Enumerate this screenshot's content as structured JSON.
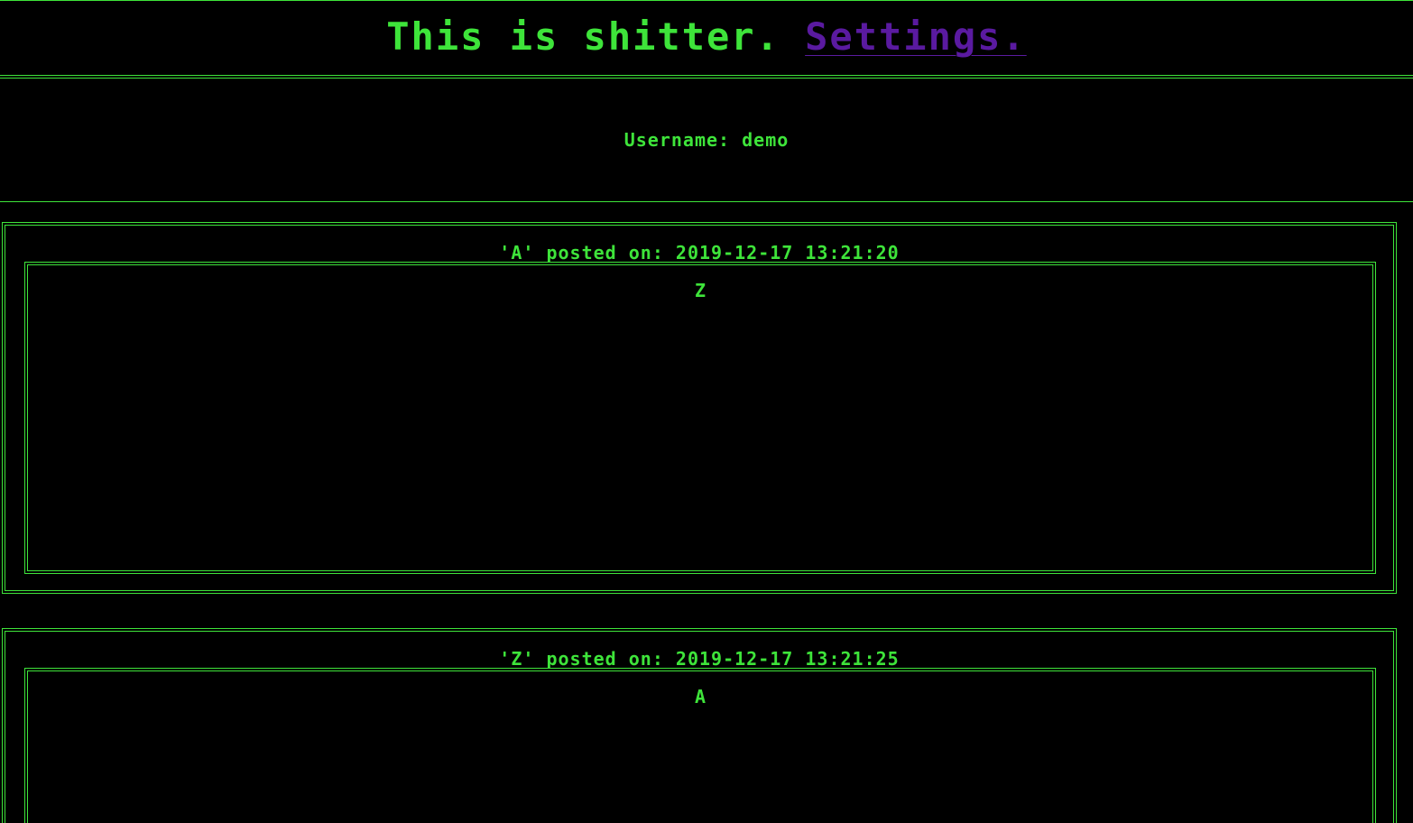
{
  "header": {
    "title": "This is shitter.",
    "settings_label": "Settings."
  },
  "user": {
    "label": "Username: demo"
  },
  "posts": [
    {
      "meta": "'A' posted on: 2019-12-17 13:21:20",
      "content": "Z"
    },
    {
      "meta": "'Z' posted on: 2019-12-17 13:21:25",
      "content": "A"
    }
  ],
  "colors": {
    "accent": "#3ee43a",
    "link": "#5a1aa0",
    "background": "#000000"
  }
}
